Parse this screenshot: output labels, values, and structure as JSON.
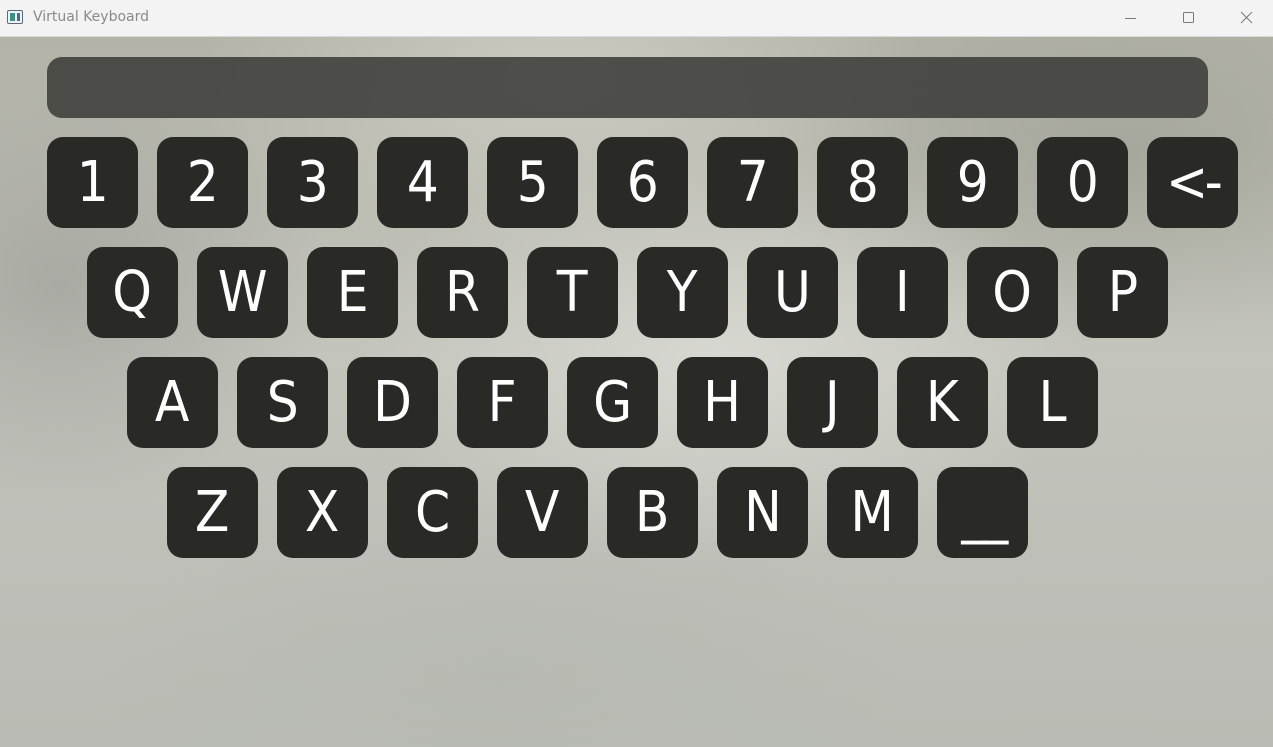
{
  "window": {
    "title": "Virtual Keyboard"
  },
  "titlebar_icons": {
    "app": "app-window-icon",
    "minimize": "minimize-icon",
    "maximize": "maximize-icon",
    "close": "close-icon"
  },
  "text_display": {
    "value": ""
  },
  "keyboard": {
    "row1": [
      "1",
      "2",
      "3",
      "4",
      "5",
      "6",
      "7",
      "8",
      "9",
      "0",
      "<-"
    ],
    "row2": [
      "Q",
      "W",
      "E",
      "R",
      "T",
      "Y",
      "U",
      "I",
      "O",
      "P"
    ],
    "row3": [
      "A",
      "S",
      "D",
      "F",
      "G",
      "H",
      "J",
      "K",
      "L"
    ],
    "row4": [
      "Z",
      "X",
      "C",
      "V",
      "B",
      "N",
      "M",
      "__"
    ]
  },
  "colors": {
    "key_background": "#292926",
    "key_text": "#ffffff",
    "display_background": "#3c3c3a",
    "titlebar_background": "#f3f3f3"
  }
}
